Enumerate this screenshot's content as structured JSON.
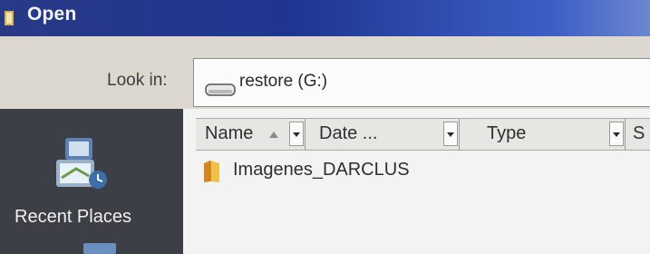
{
  "window": {
    "title": "Open"
  },
  "look_in": {
    "label": "Look in:",
    "value": "restore (G:)"
  },
  "places": {
    "recent": "Recent Places"
  },
  "columns": [
    {
      "label": "Name",
      "sorted": "ascending"
    },
    {
      "label": "Date ..."
    },
    {
      "label": "Type"
    },
    {
      "label": "S"
    }
  ],
  "files": [
    {
      "name": "Imagenes_DARCLUS",
      "kind": "folder"
    }
  ],
  "icons": {
    "title": "dialog-icon",
    "drive": "drive-icon",
    "recent": "recent-places-icon",
    "folder": "folder-icon"
  },
  "colors": {
    "titlebar": "#283a86",
    "dialog_bg": "#dcd7cc",
    "places_bg": "#3c3f45",
    "list_bg": "#f2f3f2",
    "folder": "#e6a128"
  }
}
